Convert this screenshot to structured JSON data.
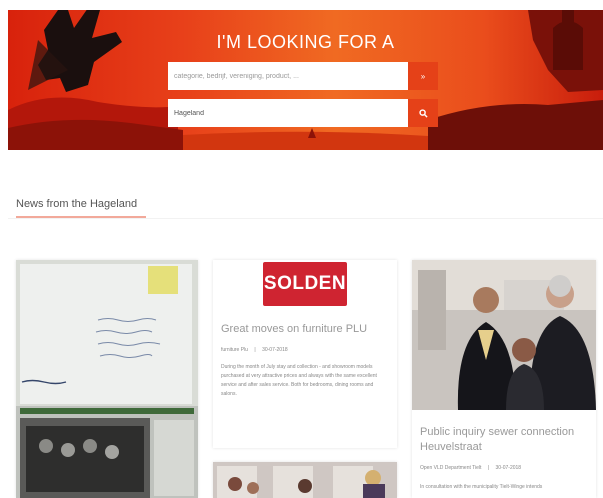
{
  "hero": {
    "title": "I'M LOOKING FOR A",
    "search_placeholder": "categorie, bedrijf, vereniging, product, ...",
    "search_button_icon": "chevron-right-icon",
    "location_value": "Hageland",
    "location_button_icon": "search-icon",
    "colors": {
      "primary": "#e54118",
      "dark": "#c81d0c"
    }
  },
  "news": {
    "section_title": "News from the Hageland",
    "cards": [
      {
        "image_alt": "letter-photo"
      },
      {
        "logo_text": "SOLDEN",
        "title": "Great moves on furniture PLU",
        "author": "furniture Plu",
        "date": "30-07-2018",
        "body": "During the month of July stay and collection - and showroom models purchased at very attractive prices and always with the same excellent service and after sales service. Both for bedrooms, dining rooms and salons."
      },
      {
        "title": "Public inquiry sewer connection Heuvelstraat",
        "author": "Open VLD Department Tielt",
        "date": "30-07-2018",
        "body": "In consultation with the municipality Tielt-Winge intends"
      }
    ]
  }
}
